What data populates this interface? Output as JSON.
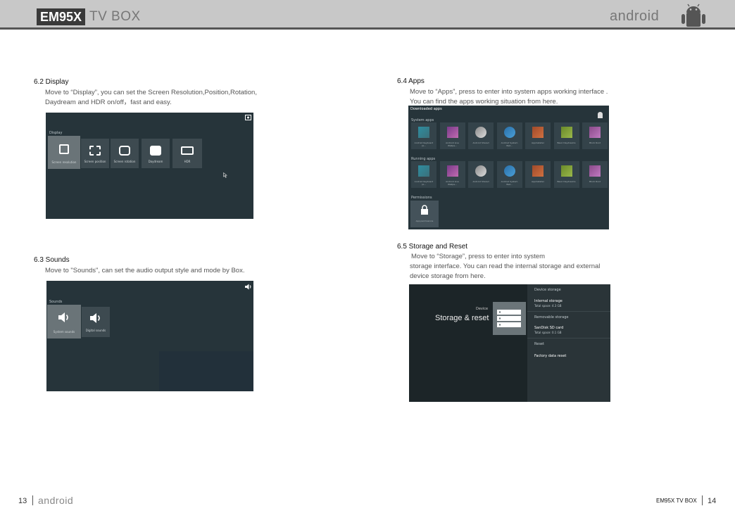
{
  "header": {
    "brand": "EM95X",
    "subtitle": "TV BOX",
    "android_wordmark": "android",
    "robot_icon": "android-robot-icon"
  },
  "left": {
    "display": {
      "title": "6.2 Display",
      "line1": "Move to “Display”, you can set the Screen Resolution,Position,Rotation,",
      "line2": "Daydream and HDR on/off，fast and easy.",
      "screen": {
        "header": "Display",
        "tiles": [
          "Screen resolution",
          "Screen position",
          "Screen rotation",
          "Daydream",
          "HDR"
        ]
      }
    },
    "sounds": {
      "title": "6.3 Sounds",
      "line1": "Move to \"Sounds\", can set the audio output style and mode by Box.",
      "screen": {
        "header": "Sounds",
        "tiles": [
          "System sounds",
          "Digital sounds"
        ]
      }
    }
  },
  "right": {
    "apps": {
      "title": "6.4 Apps",
      "line1": "Move to “Apps”, press to enter into system apps working interface .",
      "line2": "You can find the apps working situation from here.",
      "screen": {
        "header": "Downloaded apps",
        "system_label": "System apps",
        "running_label": "Running apps",
        "permissions_label": "Permissions",
        "permission_tile": "App permissions",
        "apps": [
          "Android Keyboard (A...",
          "Android Live Wallpa...",
          "Android Shared",
          "Android System Wet...",
          "AppInstaller",
          "Basic Daydreams",
          "Block Root"
        ]
      }
    },
    "storage": {
      "title": "6.5 Storage and Reset",
      "line1": "Move to “Storage”, press to enter into system",
      "line2": "storage interface. You can read the internal storage and external",
      "line3": "device storage from here.",
      "screen": {
        "device_label": "Device",
        "main_title": "Storage & reset",
        "sec_device": "Device storage",
        "internal": "Internal storage",
        "internal_sub": "Total space: 4.3 GB",
        "sec_removable": "Removable storage",
        "sd": "SanDisk SD card",
        "sd_sub": "Total space: 0.1 GB",
        "sec_reset": "Reset",
        "factory": "Factory data reset"
      }
    }
  },
  "footer": {
    "left_page": "13",
    "left_android": "android",
    "right_brand": "EM95X TV BOX",
    "right_page": "14"
  }
}
